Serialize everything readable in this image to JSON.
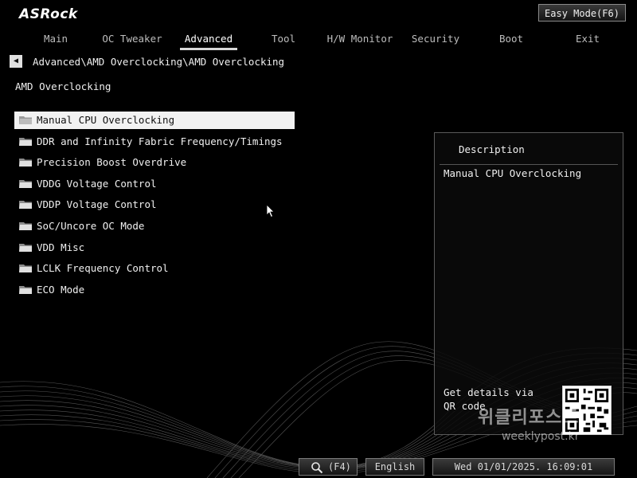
{
  "logo": {
    "text": "ASRock"
  },
  "easy_mode": {
    "label": "Easy Mode(F6)"
  },
  "nav": {
    "tabs": [
      {
        "label": "Main"
      },
      {
        "label": "OC Tweaker"
      },
      {
        "label": "Advanced",
        "active": true
      },
      {
        "label": "Tool"
      },
      {
        "label": "H/W Monitor"
      },
      {
        "label": "Security"
      },
      {
        "label": "Boot"
      },
      {
        "label": "Exit"
      }
    ]
  },
  "breadcrumb": {
    "path": "Advanced\\AMD Overclocking\\AMD Overclocking"
  },
  "page": {
    "title": "AMD Overclocking"
  },
  "menu": {
    "items": [
      {
        "label": "Manual CPU Overclocking",
        "selected": true
      },
      {
        "label": "DDR and Infinity Fabric Frequency/Timings"
      },
      {
        "label": "Precision Boost Overdrive"
      },
      {
        "label": "VDDG Voltage Control"
      },
      {
        "label": "VDDP Voltage Control"
      },
      {
        "label": "SoC/Uncore OC Mode"
      },
      {
        "label": "VDD Misc"
      },
      {
        "label": "LCLK Frequency Control"
      },
      {
        "label": "ECO Mode"
      }
    ]
  },
  "description": {
    "title": "Description",
    "text": "Manual CPU Overclocking",
    "qr_text": "Get details via QR code"
  },
  "watermark": {
    "brand": "위클리포스트",
    "url": "weeklypost.kr"
  },
  "footer": {
    "search_label": "(F4)",
    "language": "English",
    "datetime": "Wed 01/01/2025. 16:09:01"
  },
  "colors": {
    "background": "#000000",
    "highlight": "#f2f2f2",
    "text": "#f0f0f0"
  }
}
